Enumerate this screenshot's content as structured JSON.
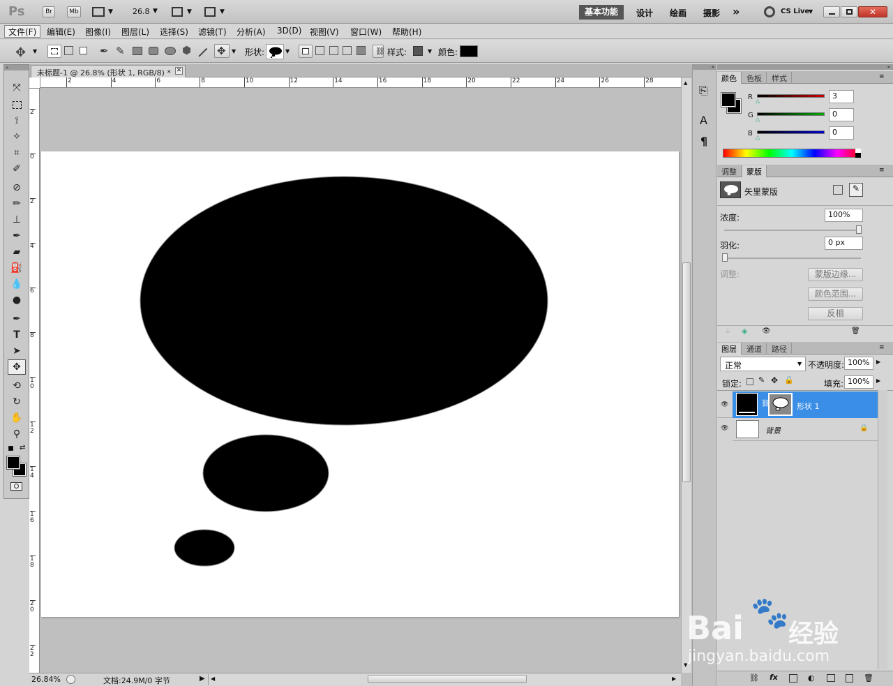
{
  "app": {
    "logo": "Ps",
    "zoom_combo": "26.8"
  },
  "topbar": {
    "bridge": "Br",
    "minibridge": "Mb",
    "workspaces": [
      "基本功能",
      "设计",
      "绘画",
      "摄影"
    ],
    "more": "»",
    "cslive": "CS Live"
  },
  "menu": [
    "文件(F)",
    "编辑(E)",
    "图像(I)",
    "图层(L)",
    "选择(S)",
    "滤镜(T)",
    "分析(A)",
    "3D(D)",
    "视图(V)",
    "窗口(W)",
    "帮助(H)"
  ],
  "options": {
    "shape_label": "形状:",
    "style_label": "样式:",
    "color_label": "颜色:",
    "color_value": "#000000"
  },
  "document": {
    "tab_title": "未标题-1 @ 26.8% (形状 1, RGB/8) *",
    "ruler_top": [
      "2",
      "4",
      "6",
      "8",
      "10",
      "12",
      "14",
      "16",
      "18",
      "20",
      "22",
      "24",
      "26",
      "28"
    ],
    "ruler_left": [
      "2",
      "0",
      "2",
      "4",
      "6",
      "8",
      "1 0",
      "1 2",
      "1 4",
      "1 6",
      "1 8",
      "2 0",
      "2 2"
    ],
    "shapes_color": "#000000"
  },
  "status": {
    "zoom": "26.84%",
    "doc": "文档:24.9M/0 字节"
  },
  "color_panel": {
    "tabs": [
      "颜色",
      "色板",
      "样式"
    ],
    "channels": [
      {
        "name": "R",
        "value": "3",
        "color": "#cc0000"
      },
      {
        "name": "G",
        "value": "0",
        "color": "#00aa00"
      },
      {
        "name": "B",
        "value": "0",
        "color": "#0000cc"
      }
    ]
  },
  "masks_panel": {
    "tabs": [
      "调整",
      "蒙版"
    ],
    "title": "矢里蒙版",
    "density_label": "浓度:",
    "density_value": "100%",
    "feather_label": "羽化:",
    "feather_value": "0 px",
    "refine_label": "调整:",
    "buttons": [
      "蒙版边缘...",
      "颜色范围...",
      "反相"
    ]
  },
  "layers_panel": {
    "tabs": [
      "图层",
      "通道",
      "路径"
    ],
    "blend": "正常",
    "opacity_label": "不透明度:",
    "opacity_value": "100%",
    "lock_label": "锁定:",
    "fill_label": "填充:",
    "fill_value": "100%",
    "layers": [
      {
        "name": "形状 1",
        "selected": true
      },
      {
        "name": "背景",
        "selected": false
      }
    ]
  },
  "watermark": {
    "text1": "Bai",
    "text2": "经验",
    "text3": "jingyan.baidu.com"
  }
}
